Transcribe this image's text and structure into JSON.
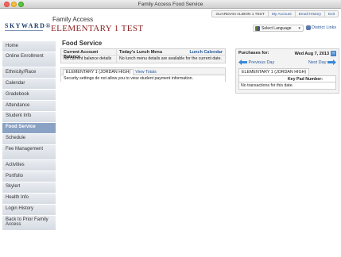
{
  "window": {
    "title": "Family Access Food Service"
  },
  "header": {
    "logo_text": "SKYWARD®",
    "app_name": "Family Access",
    "school_name": "ELEMENTARY 1 TEST",
    "user": "GUARDIAN ALBION 1 TEST",
    "links": {
      "my_account": "My Account",
      "email_history": "Email History",
      "exit": "Exit"
    },
    "select_language": "Select Language",
    "district_links": "District Links"
  },
  "sidebar": {
    "items": [
      {
        "label": "Home"
      },
      {
        "label": "Online Enrollment"
      },
      {
        "label": "Ethnicity/Race"
      },
      {
        "label": "Calendar"
      },
      {
        "label": "Gradebook"
      },
      {
        "label": "Attendance"
      },
      {
        "label": "Student Info"
      },
      {
        "label": "Food Service"
      },
      {
        "label": "Schedule"
      },
      {
        "label": "Fee Management"
      },
      {
        "label": "Activities"
      },
      {
        "label": "Portfolio"
      },
      {
        "label": "Skylert"
      },
      {
        "label": "Health Info"
      },
      {
        "label": "Login History"
      },
      {
        "label": "Back to Prior Family Access"
      }
    ]
  },
  "main": {
    "title": "Food Service",
    "balance": {
      "header": "Current Account Balance",
      "value": "No current balance details"
    },
    "lunch": {
      "header": "Today's Lunch Menu",
      "calendar_link": "Lunch Calendar",
      "message": "No lunch menu details are available for the current date."
    },
    "payment": {
      "tab": "ELEMENTARY 1 (JORDAN HIGH)",
      "view_totals": "View Totals",
      "message": "Security settings do not allow you to view student payment information."
    },
    "purchases": {
      "label": "Purchases for:",
      "date": "Wed Aug 7, 2013",
      "previous_day": "Previous Day",
      "next_day": "Next Day",
      "school_tab": "ELEMENTARY 1 (JORDAN HIGH)",
      "key_pad": "Key Pad Number:",
      "no_transactions": "No transactions for this date."
    }
  }
}
